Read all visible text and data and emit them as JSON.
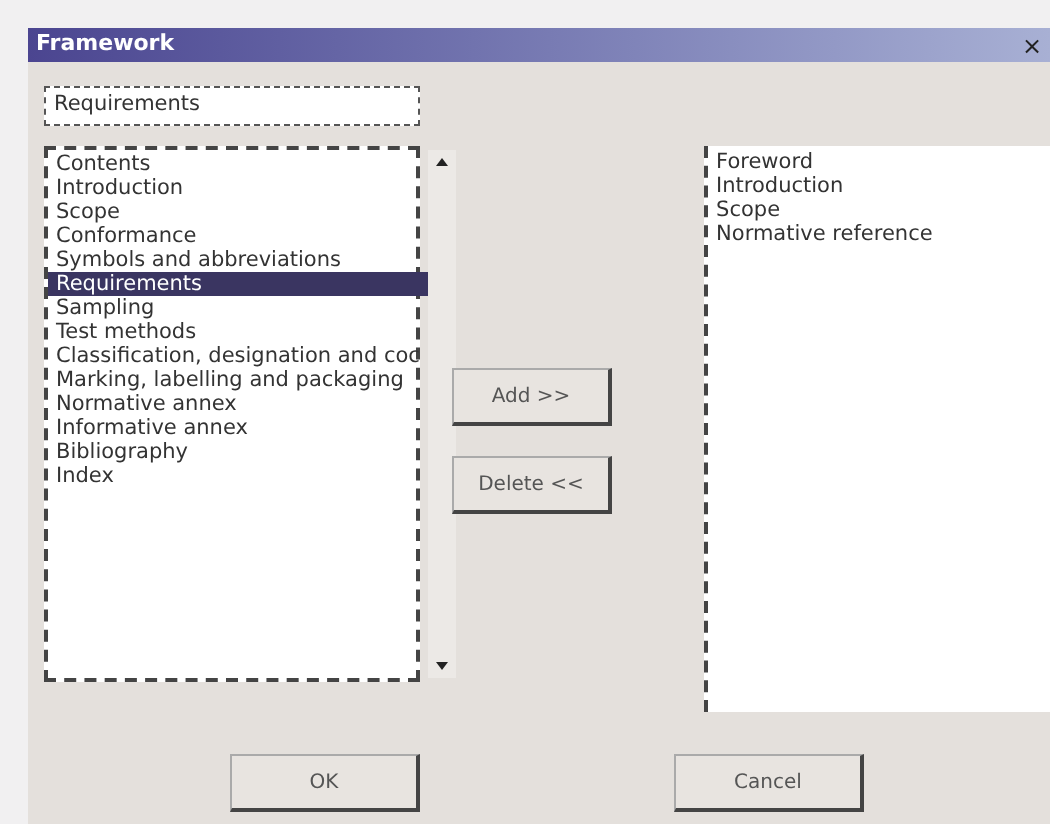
{
  "window": {
    "title": "Framework",
    "close": "×"
  },
  "name_field": {
    "value": "Requirements"
  },
  "available": {
    "items": [
      {
        "label": "Contents",
        "selected": false
      },
      {
        "label": "Introduction",
        "selected": false
      },
      {
        "label": "Scope",
        "selected": false
      },
      {
        "label": "Conformance",
        "selected": false
      },
      {
        "label": "Symbols and abbreviations",
        "selected": false
      },
      {
        "label": "Requirements",
        "selected": true
      },
      {
        "label": "Sampling",
        "selected": false
      },
      {
        "label": "Test methods",
        "selected": false
      },
      {
        "label": "Classification, designation and coc",
        "selected": false
      },
      {
        "label": "Marking, labelling and packaging",
        "selected": false
      },
      {
        "label": "Normative annex",
        "selected": false
      },
      {
        "label": "Informative annex",
        "selected": false
      },
      {
        "label": "Bibliography",
        "selected": false
      },
      {
        "label": "Index",
        "selected": false
      }
    ]
  },
  "actions": [
    "Add >>",
    "Delete <<"
  ],
  "chosen": {
    "items": [
      {
        "label": "Foreword",
        "selected": false
      },
      {
        "label": "Introduction",
        "selected": false
      },
      {
        "label": "Scope",
        "selected": false
      },
      {
        "label": "Normative reference",
        "selected": false
      }
    ]
  },
  "buttons": [
    "OK",
    "Cancel"
  ]
}
